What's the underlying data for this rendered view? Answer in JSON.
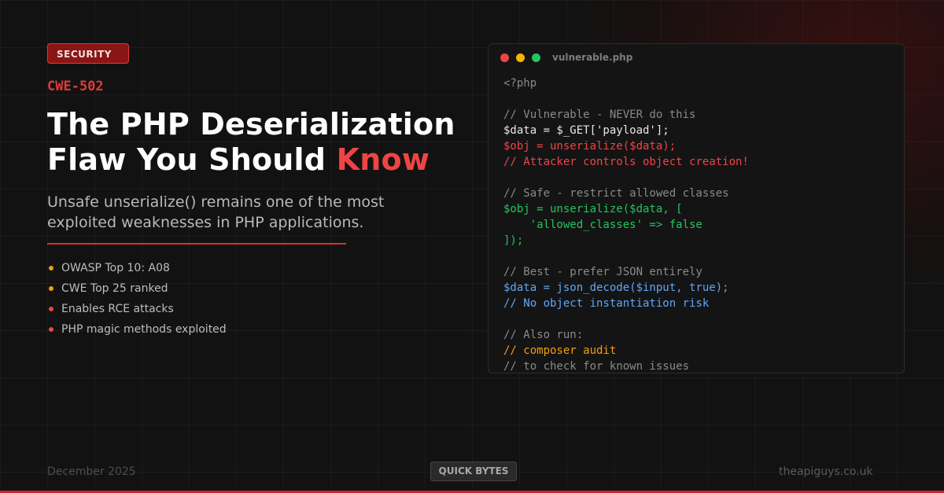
{
  "badge": "SECURITY",
  "cwe": "CWE-502",
  "title": {
    "line1": "The PHP Deserialization",
    "line2_prefix": "Flaw You Should ",
    "line2_accent": "Know"
  },
  "subtitle": "Unsafe unserialize() remains one of the most exploited weaknesses in PHP applications.",
  "bullets": [
    {
      "text": "OWASP Top 10: A08",
      "color": "#f59e0b"
    },
    {
      "text": "CWE Top 25 ranked",
      "color": "#f59e0b"
    },
    {
      "text": "Enables RCE attacks",
      "color": "#ef4444"
    },
    {
      "text": "PHP magic methods exploited",
      "color": "#ef4444"
    }
  ],
  "code_window": {
    "filename": "vulnerable.php",
    "lights": [
      "#ef4444",
      "#f5b400",
      "#22c55e"
    ],
    "lines": [
      {
        "text": "<?php",
        "color": "gray"
      },
      {
        "text": "",
        "color": "gray"
      },
      {
        "text": "// Vulnerable - NEVER do this",
        "color": "gray"
      },
      {
        "text": "$data = $_GET['payload'];",
        "color": "white"
      },
      {
        "text": "$obj = unserialize($data);",
        "color": "red"
      },
      {
        "text": "// Attacker controls object creation!",
        "color": "red"
      },
      {
        "text": "",
        "color": "gray"
      },
      {
        "text": "// Safe - restrict allowed classes",
        "color": "gray"
      },
      {
        "text": "$obj = unserialize($data, [",
        "color": "green"
      },
      {
        "text": "    'allowed_classes' => false",
        "color": "green"
      },
      {
        "text": "]);",
        "color": "green"
      },
      {
        "text": "",
        "color": "gray"
      },
      {
        "text": "// Best - prefer JSON entirely",
        "color": "gray"
      },
      {
        "text": "$data = json_decode($input, true);",
        "color": "blue"
      },
      {
        "text": "// No object instantiation risk",
        "color": "blue"
      },
      {
        "text": "",
        "color": "gray"
      },
      {
        "text": "// Also run:",
        "color": "gray"
      },
      {
        "text": "// composer audit",
        "color": "amber"
      },
      {
        "text": "// to check for known issues",
        "color": "gray"
      }
    ]
  },
  "footer": {
    "date": "December 2025",
    "tag": "QUICK BYTES",
    "site": "theapiguys.co.uk"
  },
  "colors": {
    "accent": "#ef4444",
    "background": "#121212"
  }
}
